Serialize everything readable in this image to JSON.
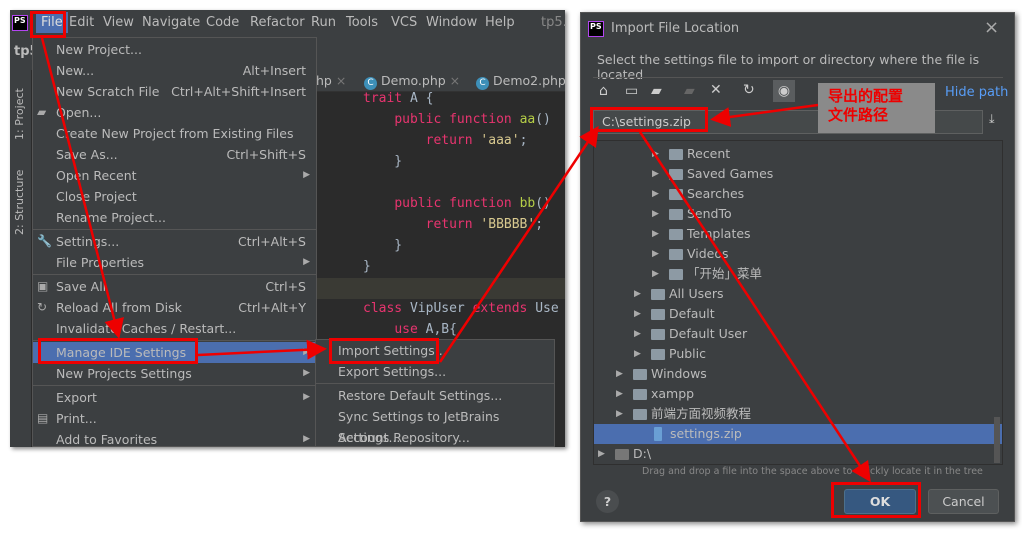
{
  "ide": {
    "logo": "PS",
    "project_short": "tp5",
    "menubar": [
      "File",
      "Edit",
      "View",
      "Navigate",
      "Code",
      "Refactor",
      "Run",
      "Tools",
      "VCS",
      "Window",
      "Help"
    ],
    "title_fragment": "tp5.",
    "side_tabs": [
      "1: Project",
      "2: Structure"
    ],
    "tabs": [
      {
        "label": "hp",
        "icon": "php-file"
      },
      {
        "label": "Demo.php",
        "icon": "class-c-icon"
      },
      {
        "label": "Demo2.php",
        "icon": "class-c-icon"
      }
    ],
    "code": [
      [
        "kw",
        "trait"
      ],
      [
        "",
        "A {"
      ]
    ],
    "code_lines": [
      "trait A {",
      "    public function aa()",
      "        return 'aaa';",
      "    }",
      "",
      "    public function bb()",
      "        return 'BBBBB';",
      "    }",
      "}",
      "",
      "class VipUser extends Use",
      "    use A,B{"
    ]
  },
  "file_menu": {
    "items": [
      {
        "label": "New Project...",
        "shortcut": "",
        "icon": ""
      },
      {
        "label": "New...",
        "shortcut": "Alt+Insert",
        "icon": ""
      },
      {
        "label": "New Scratch File",
        "shortcut": "Ctrl+Alt+Shift+Insert",
        "icon": ""
      },
      {
        "label": "Open...",
        "shortcut": "",
        "icon": "folder-open"
      },
      {
        "label": "Create New Project from Existing Files",
        "shortcut": "",
        "icon": ""
      },
      {
        "label": "Save As...",
        "shortcut": "Ctrl+Shift+S",
        "icon": ""
      },
      {
        "label": "Open Recent",
        "shortcut": "",
        "icon": "",
        "submenu": true
      },
      {
        "label": "Close Project",
        "shortcut": "",
        "icon": ""
      },
      {
        "label": "Rename Project...",
        "shortcut": "",
        "icon": "",
        "sep_after": true
      },
      {
        "label": "Settings...",
        "shortcut": "Ctrl+Alt+S",
        "icon": "wrench"
      },
      {
        "label": "File Properties",
        "shortcut": "",
        "icon": "",
        "submenu": true,
        "sep_after": true
      },
      {
        "label": "Save All",
        "shortcut": "Ctrl+S",
        "icon": "save"
      },
      {
        "label": "Reload All from Disk",
        "shortcut": "Ctrl+Alt+Y",
        "icon": "reload"
      },
      {
        "label": "Invalidate Caches / Restart...",
        "shortcut": "",
        "icon": "",
        "sep_after": true
      },
      {
        "label": "Manage IDE Settings",
        "shortcut": "",
        "icon": "",
        "submenu": true,
        "highlighted": true
      },
      {
        "label": "New Projects Settings",
        "shortcut": "",
        "icon": "",
        "submenu": true,
        "sep_after": true
      },
      {
        "label": "Export",
        "shortcut": "",
        "icon": "",
        "submenu": true
      },
      {
        "label": "Print...",
        "shortcut": "",
        "icon": "printer"
      },
      {
        "label": "Add to Favorites",
        "shortcut": "",
        "icon": "",
        "submenu": true
      }
    ]
  },
  "submenu": {
    "items": [
      {
        "label": "Import Settings..."
      },
      {
        "label": "Export Settings...",
        "sep_after": true
      },
      {
        "label": "Restore Default Settings..."
      },
      {
        "label": "Sync Settings to JetBrains Account..."
      },
      {
        "label": "Settings Repository..."
      }
    ]
  },
  "dialog": {
    "logo": "PS",
    "title": "Import File Location",
    "subtitle": "Select the settings file to import or directory where the file is located",
    "hide_path": "Hide path",
    "path_value": "C:\\settings.zip",
    "toolbar": [
      "home-icon",
      "desktop-icon",
      "project-folder-icon",
      "new-folder-icon",
      "delete-icon",
      "refresh-icon",
      "show-hidden-icon"
    ],
    "tree": [
      {
        "label": "Recent",
        "level": 3,
        "type": "folder-link"
      },
      {
        "label": "Saved Games",
        "level": 3,
        "type": "folder"
      },
      {
        "label": "Searches",
        "level": 3,
        "type": "folder"
      },
      {
        "label": "SendTo",
        "level": 3,
        "type": "folder-link"
      },
      {
        "label": "Templates",
        "level": 3,
        "type": "folder-link"
      },
      {
        "label": "Videos",
        "level": 3,
        "type": "folder"
      },
      {
        "label": "「开始」菜单",
        "level": 3,
        "type": "folder-link"
      },
      {
        "label": "All Users",
        "level": 2,
        "type": "folder-link"
      },
      {
        "label": "Default",
        "level": 2,
        "type": "folder"
      },
      {
        "label": "Default User",
        "level": 2,
        "type": "folder-link"
      },
      {
        "label": "Public",
        "level": 2,
        "type": "folder"
      },
      {
        "label": "Windows",
        "level": 1,
        "type": "folder"
      },
      {
        "label": "xampp",
        "level": 1,
        "type": "folder"
      },
      {
        "label": "前端方面视频教程",
        "level": 1,
        "type": "folder"
      },
      {
        "label": "settings.zip",
        "level": 1,
        "type": "zip",
        "selected": true
      },
      {
        "label": "D:\\",
        "level": 0,
        "type": "drive"
      }
    ],
    "hint": "Drag and drop a file into the space above to quickly locate it in the tree",
    "ok": "OK",
    "cancel": "Cancel",
    "help": "?"
  },
  "annotation": {
    "note": "导出的配置\n文件路径",
    "color": "#e00000"
  },
  "colors": {
    "accent": "#4b6eaf",
    "bg": "#3c3f41",
    "editor_bg": "#2b2b2b",
    "link": "#589df6"
  }
}
